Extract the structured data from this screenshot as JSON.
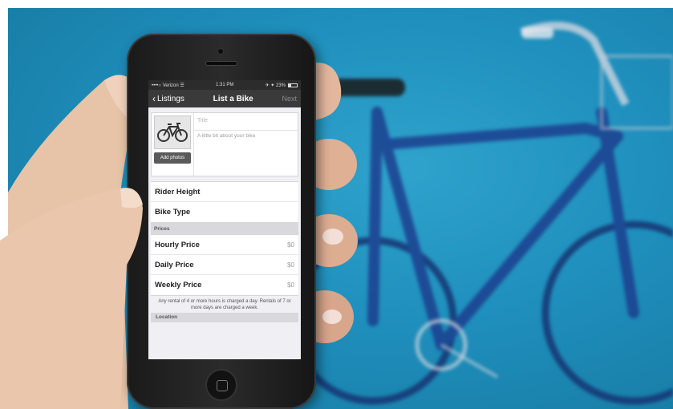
{
  "status_bar": {
    "carrier": "••••○ Verizon ☰",
    "time": "1:31 PM",
    "battery": "✈ ✦ 23%"
  },
  "nav": {
    "back_label": "Listings",
    "title": "List a Bike",
    "next_label": "Next"
  },
  "listing": {
    "title_placeholder": "Title",
    "description_placeholder": "A little bit about your bike",
    "add_photos_label": "Add photos"
  },
  "details": {
    "rows": [
      {
        "label": "Rider Height"
      },
      {
        "label": "Bike Type"
      }
    ]
  },
  "prices": {
    "section_label": "Prices",
    "rows": [
      {
        "label": "Hourly Price",
        "value": "$0"
      },
      {
        "label": "Daily Price",
        "value": "$0"
      },
      {
        "label": "Weekly Price",
        "value": "$0"
      }
    ],
    "note": "Any rental of 4 or more hours is charged a day. Rentals of 7 or more days are charged a week."
  },
  "location": {
    "section_label": "Location"
  },
  "colors": {
    "background_blue": "#1f8fbd",
    "bike_frame": "#1c3f8c",
    "nav_bar": "#3a3a3a",
    "screen_bg": "#efeff4"
  },
  "icons": {
    "back": "chevron-left-icon",
    "bike_placeholder": "bicycle-icon"
  }
}
